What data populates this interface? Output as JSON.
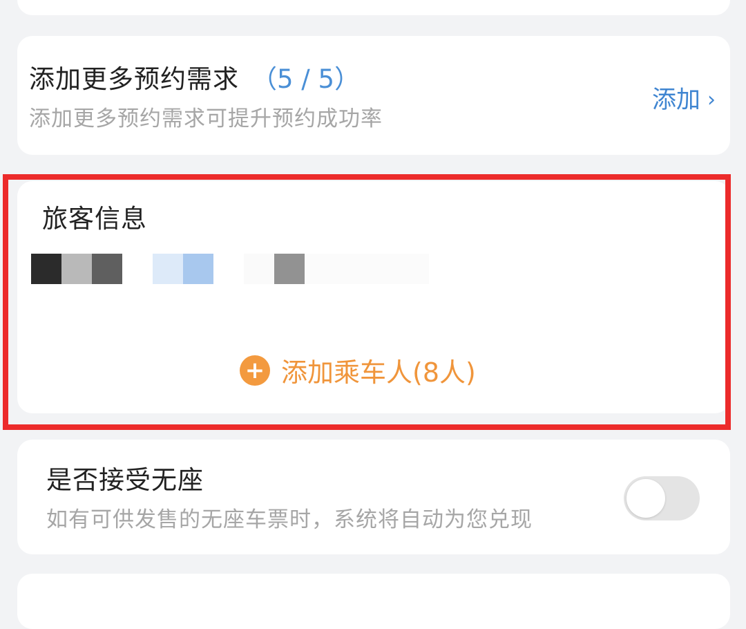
{
  "more_requests": {
    "title": "添加更多预约需求",
    "count": "（5 / 5）",
    "subtitle": "添加更多预约需求可提升预约成功率",
    "add_label": "添加",
    "chevron": "›"
  },
  "passenger_info": {
    "title": "旅客信息",
    "add_passenger_label": "添加乘车人(8人)",
    "plus_icon": "+"
  },
  "no_seat": {
    "title": "是否接受无座",
    "subtitle": "如有可供发售的无座车票时，系统将自动为您兑现",
    "toggle_on": false
  },
  "colors": {
    "accent_blue": "#3f85d1",
    "accent_orange": "#f0953b",
    "highlight_red": "#ec2b2b"
  }
}
